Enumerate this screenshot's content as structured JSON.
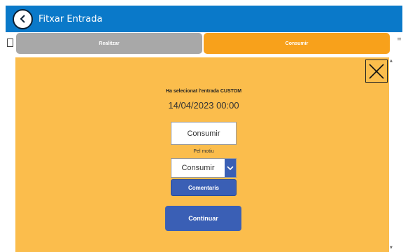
{
  "header": {
    "title": "Fitxar Entrada",
    "back_icon": "back-arrow-icon",
    "background": "#0a79c9"
  },
  "tabs": [
    {
      "label": "Realitzar",
      "color": "#a8a8a8",
      "selected": false
    },
    {
      "label": "Consumir",
      "color": "#f8a11b",
      "selected": true
    }
  ],
  "side": {
    "left_icon": "checkbox-icon",
    "right_icon": "menu-lines-icon",
    "right_glyph": "≡"
  },
  "panel": {
    "background": "#fbbd4c",
    "close_icon": "close-icon",
    "selected_label": "Ha selecionat l'entrada CUSTOM",
    "date": "14/04/2023 00:00",
    "action_value": "Consumir",
    "reason_label": "Pel motiu",
    "reason_value": "Consumir",
    "reason_arrow_icon": "chevron-down-icon",
    "comments_label": "Comentaris",
    "continue_label": "Continuar",
    "button_color": "#3a5fb5"
  },
  "scrollbar": {
    "up_glyph": "▲",
    "down_glyph": "▼"
  }
}
